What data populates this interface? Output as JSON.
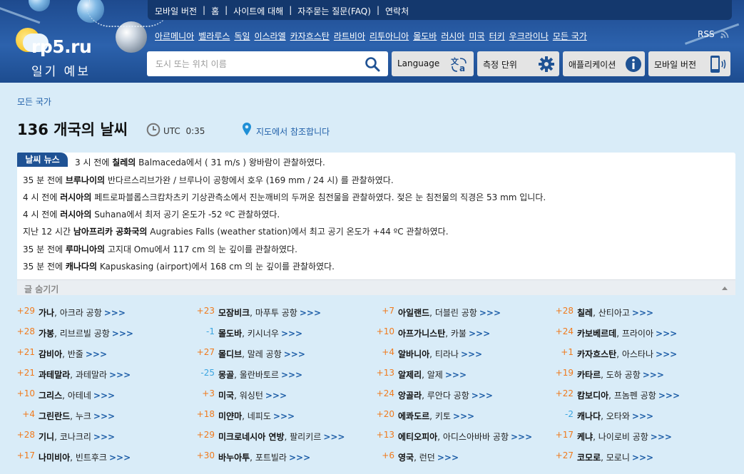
{
  "topbar": {
    "items": [
      "모바일 버전",
      "홈",
      "사이트에 대해",
      "자주묻는 질문(FAQ)",
      "연락처"
    ]
  },
  "logo": {
    "brand": "rp5.ru",
    "subtitle": "일기 예보"
  },
  "countries": [
    "아르메니아",
    "벨라루스",
    "독일",
    "이스라엘",
    "카자흐스탄",
    "라트비아",
    "리투아니아",
    "몰도바",
    "러시아",
    "미국",
    "터키",
    "우크라이나",
    "모든 국가"
  ],
  "rss": "RSS",
  "search": {
    "placeholder": "도시 또는 위치 이름",
    "value": ""
  },
  "buttons": {
    "language": "Language",
    "units": "측정 단위",
    "apps": "애플리케이션",
    "mobile": "모바일 버전"
  },
  "breadcrumb": "모든 국가",
  "page": {
    "title": "136 개국의 날씨",
    "utc_label": "UTC",
    "utc_time": "0:35",
    "map_link": "지도에서 참조합니다"
  },
  "news": {
    "tag": "날씨 뉴스",
    "hide_label": "글 숨기기",
    "lines": [
      [
        {
          "t": "3 시 전에 "
        },
        {
          "t": "칠레의",
          "b": true
        },
        {
          "t": " Balmaceda에서 ( 31 m/s ) 왕바람이 관찰하였다."
        }
      ],
      [
        {
          "t": "35 분 전에 "
        },
        {
          "t": "브루나이의",
          "b": true
        },
        {
          "t": " 반다르스리브가완 / 브루나이 공항에서 호우 (169 mm / 24 시) 를 관찰하였다."
        }
      ],
      [
        {
          "t": "4 시 전에 "
        },
        {
          "t": "러시아의",
          "b": true
        },
        {
          "t": " 페트로파블롭스크캄차츠키 기상관측소에서 진눈깨비의 두꺼운 침전물을 관찰하였다. 젖은 눈 침전물의 직경은 53 mm 입니다."
        }
      ],
      [
        {
          "t": "4 시 전에 "
        },
        {
          "t": "러시아의",
          "b": true
        },
        {
          "t": " Suhana에서 최저 공기 온도가 -52 ºC 관찰하였다."
        }
      ],
      [
        {
          "t": "지난 12 시간 "
        },
        {
          "t": "남아프리카 공화국의",
          "b": true
        },
        {
          "t": " Augrabies Falls (weather station)에서 최고 공기 온도가 +44 ºC 관찰하였다."
        }
      ],
      [
        {
          "t": "35 분 전에 "
        },
        {
          "t": "루마니아의",
          "b": true
        },
        {
          "t": " 고지대 Omu에서 117 cm 의 눈 깊이를 관찰하였다."
        }
      ],
      [
        {
          "t": "35 분 전에 "
        },
        {
          "t": "캐나다의",
          "b": true
        },
        {
          "t": " Kapuskasing (airport)에서 168 cm 의 눈 깊이를 관찰하였다."
        }
      ]
    ]
  },
  "countries_grid": [
    [
      {
        "temp": "+29",
        "country": "가나",
        "city": "아크라 공항"
      },
      {
        "temp": "+28",
        "country": "가봉",
        "city": "리브르빌 공항"
      },
      {
        "temp": "+21",
        "country": "감비아",
        "city": "반줄"
      },
      {
        "temp": "+21",
        "country": "과테말라",
        "city": "과테말라"
      },
      {
        "temp": "+10",
        "country": "그리스",
        "city": "아테네"
      },
      {
        "temp": "+4",
        "country": "그린란드",
        "city": "누크"
      },
      {
        "temp": "+28",
        "country": "기니",
        "city": "코나크리"
      },
      {
        "temp": "+17",
        "country": "나미비아",
        "city": "빈트후크"
      }
    ],
    [
      {
        "temp": "+23",
        "country": "모잠비크",
        "city": "마푸투 공항"
      },
      {
        "temp": "-1",
        "country": "몰도바",
        "city": "키시너우"
      },
      {
        "temp": "+27",
        "country": "몰디브",
        "city": "말레 공항"
      },
      {
        "temp": "-25",
        "country": "몽골",
        "city": "울란바토르"
      },
      {
        "temp": "+3",
        "country": "미국",
        "city": "워싱턴"
      },
      {
        "temp": "+18",
        "country": "미얀마",
        "city": "네피도"
      },
      {
        "temp": "+29",
        "country": "미크로네시아 연방",
        "city": "팔리키르"
      },
      {
        "temp": "+30",
        "country": "바누아투",
        "city": "포트빌라"
      }
    ],
    [
      {
        "temp": "+7",
        "country": "아일랜드",
        "city": "더블린 공항"
      },
      {
        "temp": "+10",
        "country": "아프가니스탄",
        "city": "카불"
      },
      {
        "temp": "+4",
        "country": "알바니아",
        "city": "티라나"
      },
      {
        "temp": "+13",
        "country": "알제리",
        "city": "알제"
      },
      {
        "temp": "+24",
        "country": "앙골라",
        "city": "루안다 공항"
      },
      {
        "temp": "+20",
        "country": "에콰도르",
        "city": "키토"
      },
      {
        "temp": "+13",
        "country": "에티오피아",
        "city": "아디스아바바 공항"
      },
      {
        "temp": "+6",
        "country": "영국",
        "city": "런던"
      }
    ],
    [
      {
        "temp": "+28",
        "country": "칠레",
        "city": "산티아고"
      },
      {
        "temp": "+24",
        "country": "카보베르데",
        "city": "프라이아"
      },
      {
        "temp": "+1",
        "country": "카자흐스탄",
        "city": "아스타나"
      },
      {
        "temp": "+19",
        "country": "카타르",
        "city": "도하 공항"
      },
      {
        "temp": "+22",
        "country": "캄보디아",
        "city": "프놈펜 공항"
      },
      {
        "temp": "-2",
        "country": "캐나다",
        "city": "오타와"
      },
      {
        "temp": "+17",
        "country": "케냐",
        "city": "나이로비 공항"
      },
      {
        "temp": "+27",
        "country": "코모로",
        "city": "모로니"
      }
    ]
  ],
  "more_label": ">>>",
  "colors": {
    "warm": "#f07a1c",
    "cold": "#3aa5e0",
    "link": "#1f5fa8",
    "header": "#2c62ad",
    "topbar": "#14386d"
  },
  "icons": {
    "search": "search-icon",
    "language": "translate-icon",
    "units": "gear-icon",
    "apps": "info-icon",
    "mobile": "mobile-phone-icon",
    "clock": "clock-icon",
    "map": "map-pin-icon",
    "rss": "rss-icon"
  }
}
